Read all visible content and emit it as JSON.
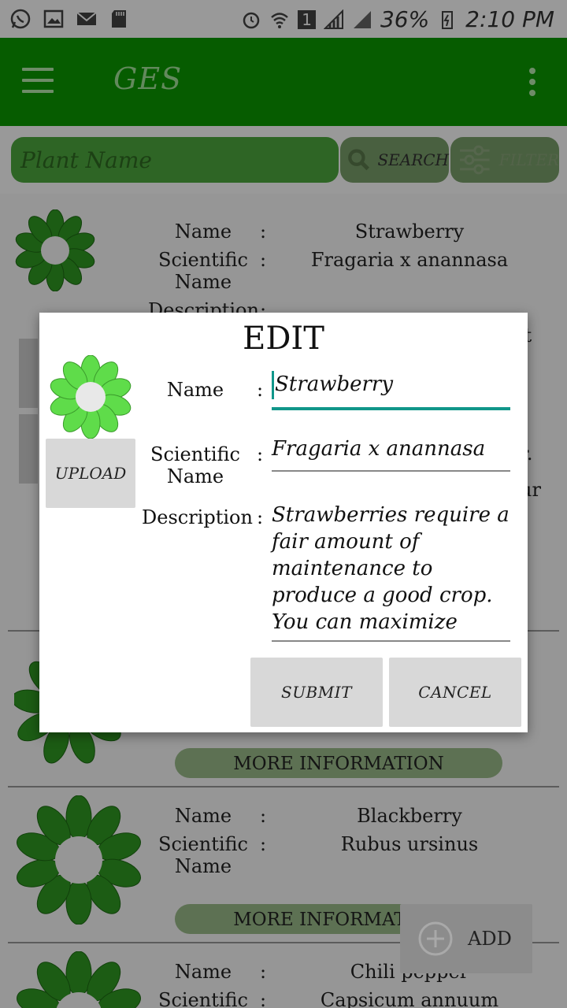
{
  "status_bar": {
    "battery": "36%",
    "time": "2:10 PM",
    "sim": "1"
  },
  "app_bar": {
    "title": "GES"
  },
  "search": {
    "placeholder": "Plant Name",
    "search_label": "SEARCH",
    "filter_label": "FILTER"
  },
  "labels": {
    "name": "Name",
    "scientific": "Scientific",
    "scientific2": "Name",
    "description": "Description",
    "colon": ":",
    "more_info": "MORE INFORMATION"
  },
  "plants": [
    {
      "name": "Strawberry",
      "scientific": "Fragaria x anannasa",
      "desc_end1": "nt",
      "desc_end2": "r.",
      "desc_end3": "ur"
    },
    {
      "name": "Blackberry",
      "scientific": "Rubus ursinus"
    },
    {
      "name": "Chili pepper",
      "scientific": "Capsicum annuum"
    }
  ],
  "fab": {
    "label": "ADD",
    "icon": "add-circle-icon"
  },
  "dialog": {
    "title": "EDIT",
    "upload_label": "UPLOAD",
    "name_label": "Name",
    "sci_label_1": "Scientific",
    "sci_label_2": "Name",
    "desc_label": "Description",
    "colon": ":",
    "name_value": "Strawberry",
    "scientific_value": "Fragaria x anannasa",
    "description_lines": [
      "Strawberries require a",
      "fair amount of",
      "maintenance to",
      "produce a good crop.",
      "You can maximize"
    ],
    "submit_label": "SUBMIT",
    "cancel_label": "CANCEL"
  },
  "colors": {
    "app_bar": "#0a9a00",
    "accent": "#10968a",
    "petal": "#3ab82a"
  }
}
